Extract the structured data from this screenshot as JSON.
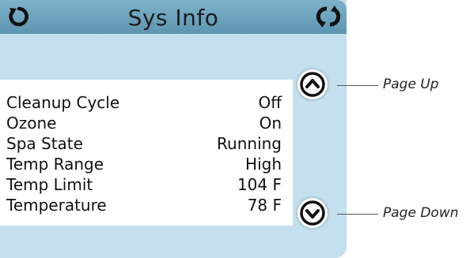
{
  "header": {
    "title": "Sys Info"
  },
  "info_rows": [
    {
      "label": "Cleanup Cycle",
      "value": "Off"
    },
    {
      "label": "Ozone",
      "value": "On"
    },
    {
      "label": "Spa State",
      "value": "Running"
    },
    {
      "label": "Temp Range",
      "value": "High"
    },
    {
      "label": "Temp Limit",
      "value": "104 F"
    },
    {
      "label": "Temperature",
      "value": "78 F"
    }
  ],
  "callouts": {
    "page_up": "Page Up",
    "page_down": "Page Down"
  },
  "icons": {
    "back": "back-icon",
    "refresh": "refresh-icon",
    "up": "chevron-up-icon",
    "down": "chevron-down-icon"
  },
  "colors": {
    "header": "#5d95b0",
    "screen": "#c4e0ef"
  }
}
